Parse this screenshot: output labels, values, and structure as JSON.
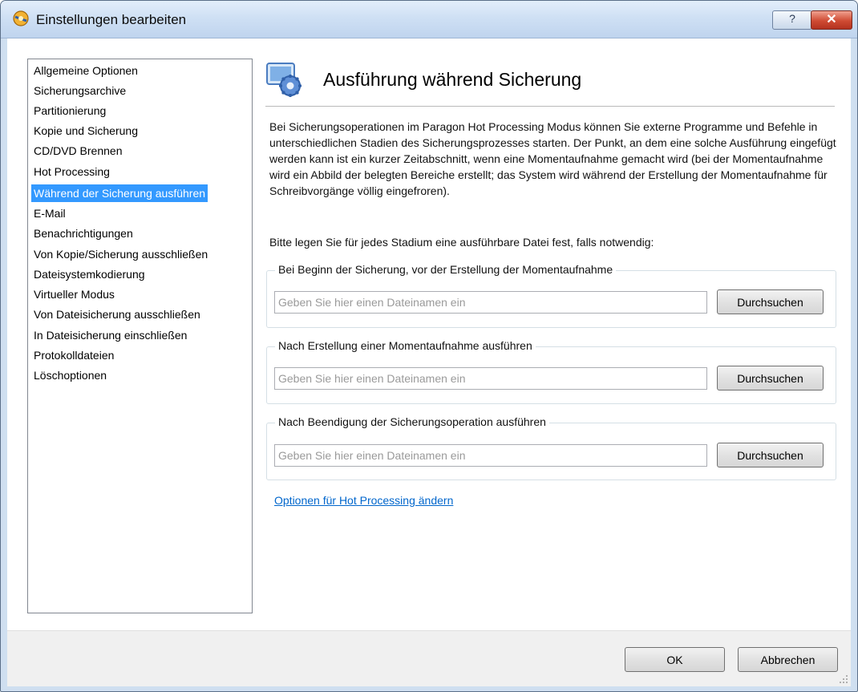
{
  "window": {
    "title": "Einstellungen bearbeiten",
    "help_label": "?",
    "close_label": "✕"
  },
  "nav": {
    "items": [
      "Allgemeine Optionen",
      "Sicherungsarchive",
      "Partitionierung",
      "Kopie und Sicherung",
      "CD/DVD Brennen",
      "Hot Processing",
      "Während der Sicherung ausführen",
      "E-Mail",
      "Benachrichtigungen",
      "Von Kopie/Sicherung ausschließen",
      "Dateisystemkodierung",
      "Virtueller Modus",
      "Von Dateisicherung ausschließen",
      "In Dateisicherung einschließen",
      "Protokolldateien",
      "Löschoptionen"
    ],
    "selected": "Während der Sicherung ausführen"
  },
  "panel": {
    "heading": "Ausführung während Sicherung",
    "description": "Bei Sicherungsoperationen im Paragon Hot Processing Modus können Sie externe Programme und Befehle in unterschiedlichen Stadien des Sicherungsprozesses starten. Der Punkt, an dem eine solche Ausführung eingefügt werden kann ist ein kurzer Zeitabschnitt, wenn eine Momentaufnahme gemacht wird (bei der Momentaufnahme wird ein Abbild der belegten Bereiche erstellt; das System wird während der Erstellung der Momentaufnahme für Schreibvorgänge völlig eingefroren).",
    "instruction": "Bitte legen Sie für jedes Stadium eine ausführbare Datei fest, falls notwendig:",
    "groups": [
      {
        "label": "Bei Beginn der Sicherung, vor der Erstellung der Momentaufnahme",
        "value": "",
        "placeholder": "Geben Sie hier einen Dateinamen ein",
        "button": "Durchsuchen"
      },
      {
        "label": "Nach Erstellung einer Momentaufnahme ausführen",
        "value": "",
        "placeholder": "Geben Sie hier einen Dateinamen ein",
        "button": "Durchsuchen"
      },
      {
        "label": "Nach Beendigung der Sicherungsoperation ausführen",
        "value": "",
        "placeholder": "Geben Sie hier einen Dateinamen ein",
        "button": "Durchsuchen"
      }
    ],
    "link": "Optionen für Hot Processing ändern"
  },
  "footer": {
    "ok": "OK",
    "cancel": "Abbrechen"
  },
  "colors": {
    "selection": "#3399ff",
    "link": "#0066cc",
    "titlebar": "#cfe0f4"
  },
  "icons": {
    "app": "paragon-logo-icon",
    "panel": "settings-gear-icon"
  }
}
